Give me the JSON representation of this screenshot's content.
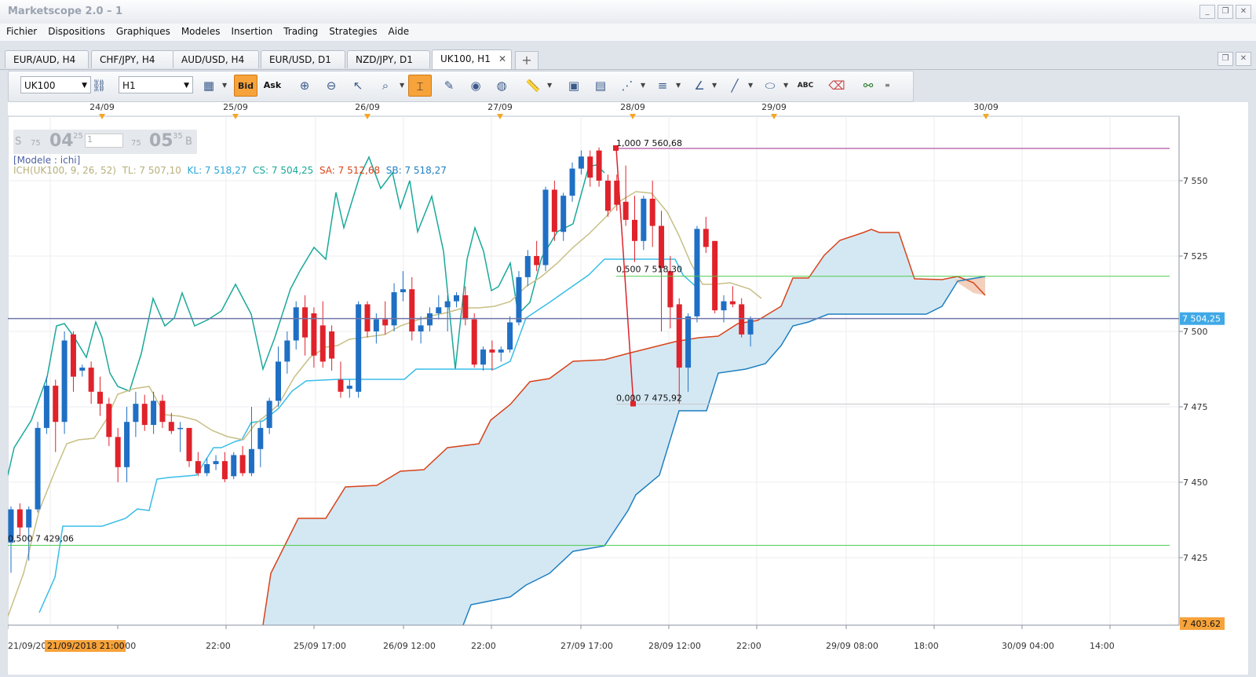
{
  "window": {
    "title": "Marketscope 2.0 – 1",
    "controls": [
      "_",
      "❐",
      "✕"
    ]
  },
  "menu": [
    "Fichier",
    "Dispositions",
    "Graphiques",
    "Modeles",
    "Insertion",
    "Trading",
    "Strategies",
    "Aide"
  ],
  "tabs": [
    "EUR/AUD, H4",
    "CHF/JPY, H4",
    "AUD/USD, H4",
    "EUR/USD, D1",
    "NZD/JPY, D1",
    "UK100, H1"
  ],
  "tab_close": "✕",
  "tab_add": "+",
  "toolbar": {
    "symbol": "UK100",
    "timeframe": "H1",
    "bid_label": "Bid",
    "ask_label": "Ask",
    "abc_label": "ABC"
  },
  "trade_box": {
    "sell_label": "S",
    "sell_small": "75",
    "sell_big": "04",
    "sell_sup": "25",
    "amount": "1",
    "buy_small": "75",
    "buy_big": "05",
    "buy_sup": "35",
    "buy_label": "B"
  },
  "legend": {
    "model": "[Modele : ichi]",
    "ich": "ICH(UK100, 9, 26, 52)",
    "tl": "TL: 7 507,10",
    "kl": "KL: 7 518,27",
    "cs": "CS: 7 504,25",
    "sa": "SA: 7 512,68",
    "sb": "SB: 7 518,27"
  },
  "top_dates": [
    "24/09",
    "25/09",
    "26/09",
    "27/09",
    "28/09",
    "29/09",
    "30/09"
  ],
  "bottom_axis": [
    "21/09/20",
    "09 12:00",
    "22:00",
    "25/09 17:00",
    "26/09 12:00",
    "22:00",
    "27/09 17:00",
    "28/09 12:00",
    "22:00",
    "29/09 08:00",
    "18:00",
    "30/09 04:00",
    "14:00"
  ],
  "crosshair_time": "21/09/2018 21:00",
  "price_ticks": [
    "7 550",
    "7 525",
    "7 500",
    "7 475",
    "7 450",
    "7 425"
  ],
  "current_price": "7 504,25",
  "min_price_label": "7 403.62",
  "fibo_labels": {
    "top": "1,000 7 560,68",
    "mid": "0,500 7 518,30",
    "bottom": "0,000 7 475,92",
    "left": "0,500 7 429,06"
  },
  "chart_data": {
    "type": "candlestick",
    "symbol": "UK100",
    "timeframe": "H1",
    "ylim": [
      7403.62,
      7565
    ],
    "candles": [
      {
        "o": 7430,
        "h": 7442,
        "l": 7420,
        "c": 7441
      },
      {
        "o": 7441,
        "h": 7443,
        "l": 7432,
        "c": 7435
      },
      {
        "o": 7435,
        "h": 7442,
        "l": 7424,
        "c": 7441
      },
      {
        "o": 7441,
        "h": 7470,
        "l": 7440,
        "c": 7468
      },
      {
        "o": 7468,
        "h": 7485,
        "l": 7466,
        "c": 7482
      },
      {
        "o": 7482,
        "h": 7484,
        "l": 7460,
        "c": 7470
      },
      {
        "o": 7470,
        "h": 7500,
        "l": 7466,
        "c": 7497
      },
      {
        "o": 7499,
        "h": 7500,
        "l": 7480,
        "c": 7485
      },
      {
        "o": 7487,
        "h": 7489,
        "l": 7485,
        "c": 7488
      },
      {
        "o": 7488,
        "h": 7490,
        "l": 7476,
        "c": 7480
      },
      {
        "o": 7480,
        "h": 7485,
        "l": 7472,
        "c": 7476
      },
      {
        "o": 7476,
        "h": 7478,
        "l": 7462,
        "c": 7465
      },
      {
        "o": 7465,
        "h": 7468,
        "l": 7450,
        "c": 7455
      },
      {
        "o": 7455,
        "h": 7475,
        "l": 7450,
        "c": 7470
      },
      {
        "o": 7470,
        "h": 7480,
        "l": 7465,
        "c": 7476
      },
      {
        "o": 7476,
        "h": 7479,
        "l": 7467,
        "c": 7469
      },
      {
        "o": 7469,
        "h": 7480,
        "l": 7466,
        "c": 7477
      },
      {
        "o": 7477,
        "h": 7479,
        "l": 7468,
        "c": 7470
      },
      {
        "o": 7470,
        "h": 7473,
        "l": 7466,
        "c": 7467
      },
      {
        "o": 7468,
        "h": 7470,
        "l": 7460,
        "c": 7468
      },
      {
        "o": 7468,
        "h": 7468,
        "l": 7455,
        "c": 7457
      },
      {
        "o": 7457,
        "h": 7460,
        "l": 7452,
        "c": 7453
      },
      {
        "o": 7453,
        "h": 7458,
        "l": 7452,
        "c": 7456
      },
      {
        "o": 7456,
        "h": 7459,
        "l": 7454,
        "c": 7457
      },
      {
        "o": 7457,
        "h": 7460,
        "l": 7450,
        "c": 7451
      },
      {
        "o": 7452,
        "h": 7460,
        "l": 7451,
        "c": 7459
      },
      {
        "o": 7459,
        "h": 7462,
        "l": 7452,
        "c": 7453
      },
      {
        "o": 7453,
        "h": 7475,
        "l": 7452,
        "c": 7461
      },
      {
        "o": 7461,
        "h": 7470,
        "l": 7455,
        "c": 7468
      },
      {
        "o": 7468,
        "h": 7478,
        "l": 7466,
        "c": 7477
      },
      {
        "o": 7477,
        "h": 7495,
        "l": 7475,
        "c": 7490
      },
      {
        "o": 7490,
        "h": 7500,
        "l": 7486,
        "c": 7497
      },
      {
        "o": 7497,
        "h": 7510,
        "l": 7494,
        "c": 7508
      },
      {
        "o": 7508,
        "h": 7512,
        "l": 7492,
        "c": 7498
      },
      {
        "o": 7506,
        "h": 7508,
        "l": 7488,
        "c": 7492
      },
      {
        "o": 7502,
        "h": 7510,
        "l": 7488,
        "c": 7490
      },
      {
        "o": 7500,
        "h": 7502,
        "l": 7487,
        "c": 7491
      },
      {
        "o": 7484,
        "h": 7490,
        "l": 7478,
        "c": 7480
      },
      {
        "o": 7481,
        "h": 7484,
        "l": 7478,
        "c": 7482
      },
      {
        "o": 7480,
        "h": 7510,
        "l": 7478,
        "c": 7509
      },
      {
        "o": 7509,
        "h": 7510,
        "l": 7498,
        "c": 7500
      },
      {
        "o": 7500,
        "h": 7506,
        "l": 7496,
        "c": 7504
      },
      {
        "o": 7504,
        "h": 7510,
        "l": 7499,
        "c": 7502
      },
      {
        "o": 7502,
        "h": 7516,
        "l": 7500,
        "c": 7513
      },
      {
        "o": 7513,
        "h": 7520,
        "l": 7510,
        "c": 7514
      },
      {
        "o": 7514,
        "h": 7518,
        "l": 7497,
        "c": 7500
      },
      {
        "o": 7500,
        "h": 7505,
        "l": 7496,
        "c": 7502
      },
      {
        "o": 7502,
        "h": 7508,
        "l": 7500,
        "c": 7506
      },
      {
        "o": 7506,
        "h": 7512,
        "l": 7504,
        "c": 7508
      },
      {
        "o": 7508,
        "h": 7512,
        "l": 7500,
        "c": 7510
      },
      {
        "o": 7510,
        "h": 7513,
        "l": 7508,
        "c": 7512
      },
      {
        "o": 7512,
        "h": 7515,
        "l": 7502,
        "c": 7504
      },
      {
        "o": 7504,
        "h": 7506,
        "l": 7488,
        "c": 7489
      },
      {
        "o": 7489,
        "h": 7495,
        "l": 7487,
        "c": 7494
      },
      {
        "o": 7494,
        "h": 7497,
        "l": 7487,
        "c": 7493
      },
      {
        "o": 7493,
        "h": 7495,
        "l": 7490,
        "c": 7494
      },
      {
        "o": 7494,
        "h": 7505,
        "l": 7493,
        "c": 7503
      },
      {
        "o": 7503,
        "h": 7520,
        "l": 7502,
        "c": 7518
      },
      {
        "o": 7518,
        "h": 7527,
        "l": 7515,
        "c": 7525
      },
      {
        "o": 7525,
        "h": 7530,
        "l": 7520,
        "c": 7522
      },
      {
        "o": 7522,
        "h": 7548,
        "l": 7520,
        "c": 7547
      },
      {
        "o": 7547,
        "h": 7550,
        "l": 7530,
        "c": 7533
      },
      {
        "o": 7533,
        "h": 7546,
        "l": 7530,
        "c": 7545
      },
      {
        "o": 7545,
        "h": 7556,
        "l": 7543,
        "c": 7554
      },
      {
        "o": 7554,
        "h": 7560,
        "l": 7552,
        "c": 7558
      },
      {
        "o": 7558,
        "h": 7560,
        "l": 7548,
        "c": 7551
      },
      {
        "o": 7560,
        "h": 7561,
        "l": 7548,
        "c": 7550
      },
      {
        "o": 7550,
        "h": 7552,
        "l": 7538,
        "c": 7540
      },
      {
        "o": 7550,
        "h": 7552,
        "l": 7540,
        "c": 7542
      },
      {
        "o": 7543,
        "h": 7555,
        "l": 7535,
        "c": 7537
      },
      {
        "o": 7537,
        "h": 7545,
        "l": 7523,
        "c": 7530
      },
      {
        "o": 7530,
        "h": 7545,
        "l": 7527,
        "c": 7544
      },
      {
        "o": 7544,
        "h": 7550,
        "l": 7528,
        "c": 7535
      },
      {
        "o": 7535,
        "h": 7540,
        "l": 7500,
        "c": 7521
      },
      {
        "o": 7520,
        "h": 7525,
        "l": 7501,
        "c": 7508
      },
      {
        "o": 7509,
        "h": 7511,
        "l": 7476,
        "c": 7488
      },
      {
        "o": 7488,
        "h": 7506,
        "l": 7480,
        "c": 7505
      },
      {
        "o": 7505,
        "h": 7535,
        "l": 7503,
        "c": 7534
      },
      {
        "o": 7534,
        "h": 7538,
        "l": 7526,
        "c": 7528
      },
      {
        "o": 7530,
        "h": 7530,
        "l": 7506,
        "c": 7507
      },
      {
        "o": 7507,
        "h": 7512,
        "l": 7503,
        "c": 7510
      },
      {
        "o": 7510,
        "h": 7515,
        "l": 7508,
        "c": 7509
      },
      {
        "o": 7509,
        "h": 7511,
        "l": 7498,
        "c": 7499
      },
      {
        "o": 7499,
        "h": 7505,
        "l": 7495,
        "c": 7504
      }
    ],
    "fibonacci": {
      "high": 7560.68,
      "low": 7475.92,
      "mid": 7518.3
    }
  }
}
